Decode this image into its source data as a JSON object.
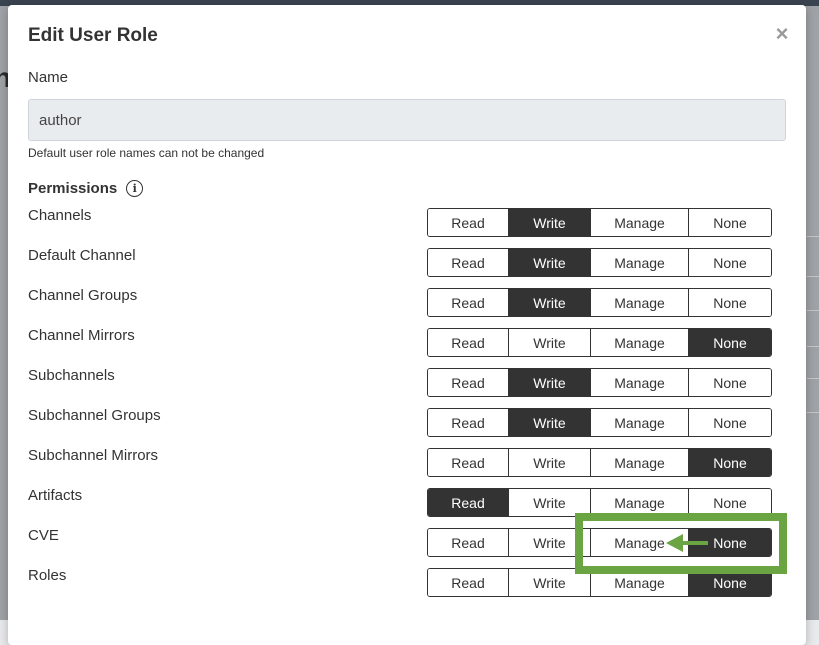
{
  "modal": {
    "title": "Edit User Role",
    "close_glyph": "×"
  },
  "name": {
    "label": "Name",
    "value": "author",
    "helper": "Default user role names can not be changed"
  },
  "permissions": {
    "heading": "Permissions",
    "info_glyph": "i",
    "options": [
      "Read",
      "Write",
      "Manage",
      "None"
    ],
    "rows": [
      {
        "label": "Channels",
        "selected": "Write"
      },
      {
        "label": "Default Channel",
        "selected": "Write"
      },
      {
        "label": "Channel Groups",
        "selected": "Write"
      },
      {
        "label": "Channel Mirrors",
        "selected": "None"
      },
      {
        "label": "Subchannels",
        "selected": "Write"
      },
      {
        "label": "Subchannel Groups",
        "selected": "Write"
      },
      {
        "label": "Subchannel Mirrors",
        "selected": "None"
      },
      {
        "label": "Artifacts",
        "selected": "Read"
      },
      {
        "label": "CVE",
        "selected": "None"
      },
      {
        "label": "Roles",
        "selected": "None"
      }
    ]
  },
  "annotation": {
    "highlight_color": "#6ba543",
    "arrow_color": "#6ba543"
  }
}
